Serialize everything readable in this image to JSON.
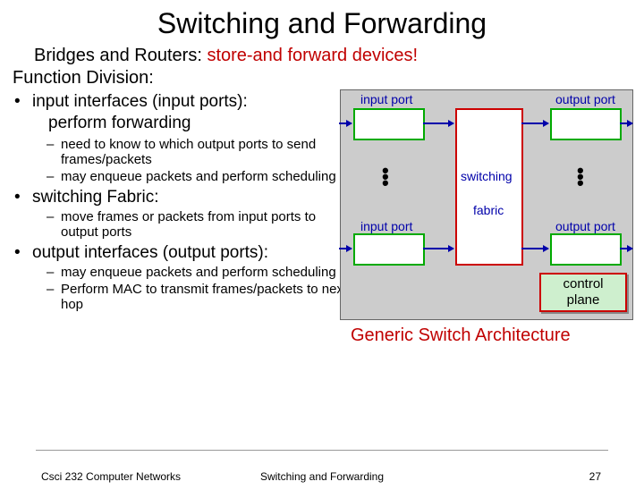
{
  "title": "Switching and Forwarding",
  "subtitle_pre": "Bridges and Routers: ",
  "subtitle_hl": "store-and forward devices!",
  "function_division": "Function Division:",
  "bullets": {
    "b1": "input interfaces (input ports):",
    "b1b": "perform forwarding",
    "b1_s1": "need to know to which output ports to send frames/packets",
    "b1_s2": "may enqueue packets and perform scheduling",
    "b2": "switching Fabric:",
    "b2_s1": "move frames or packets from input ports to output ports",
    "b3": "output interfaces (output ports):",
    "b3_s1": "may enqueue packets and perform scheduling",
    "b3_s2": "Perform MAC to transmit frames/packets to next hop"
  },
  "diagram": {
    "input_port": "input port",
    "output_port": "output port",
    "switching": "switching",
    "fabric": "fabric",
    "control": "control",
    "plane": "plane"
  },
  "caption": "Generic Switch Architecture",
  "footer": {
    "left": "Csci 232 Computer Networks",
    "center": "Switching and Forwarding",
    "right": "27"
  }
}
